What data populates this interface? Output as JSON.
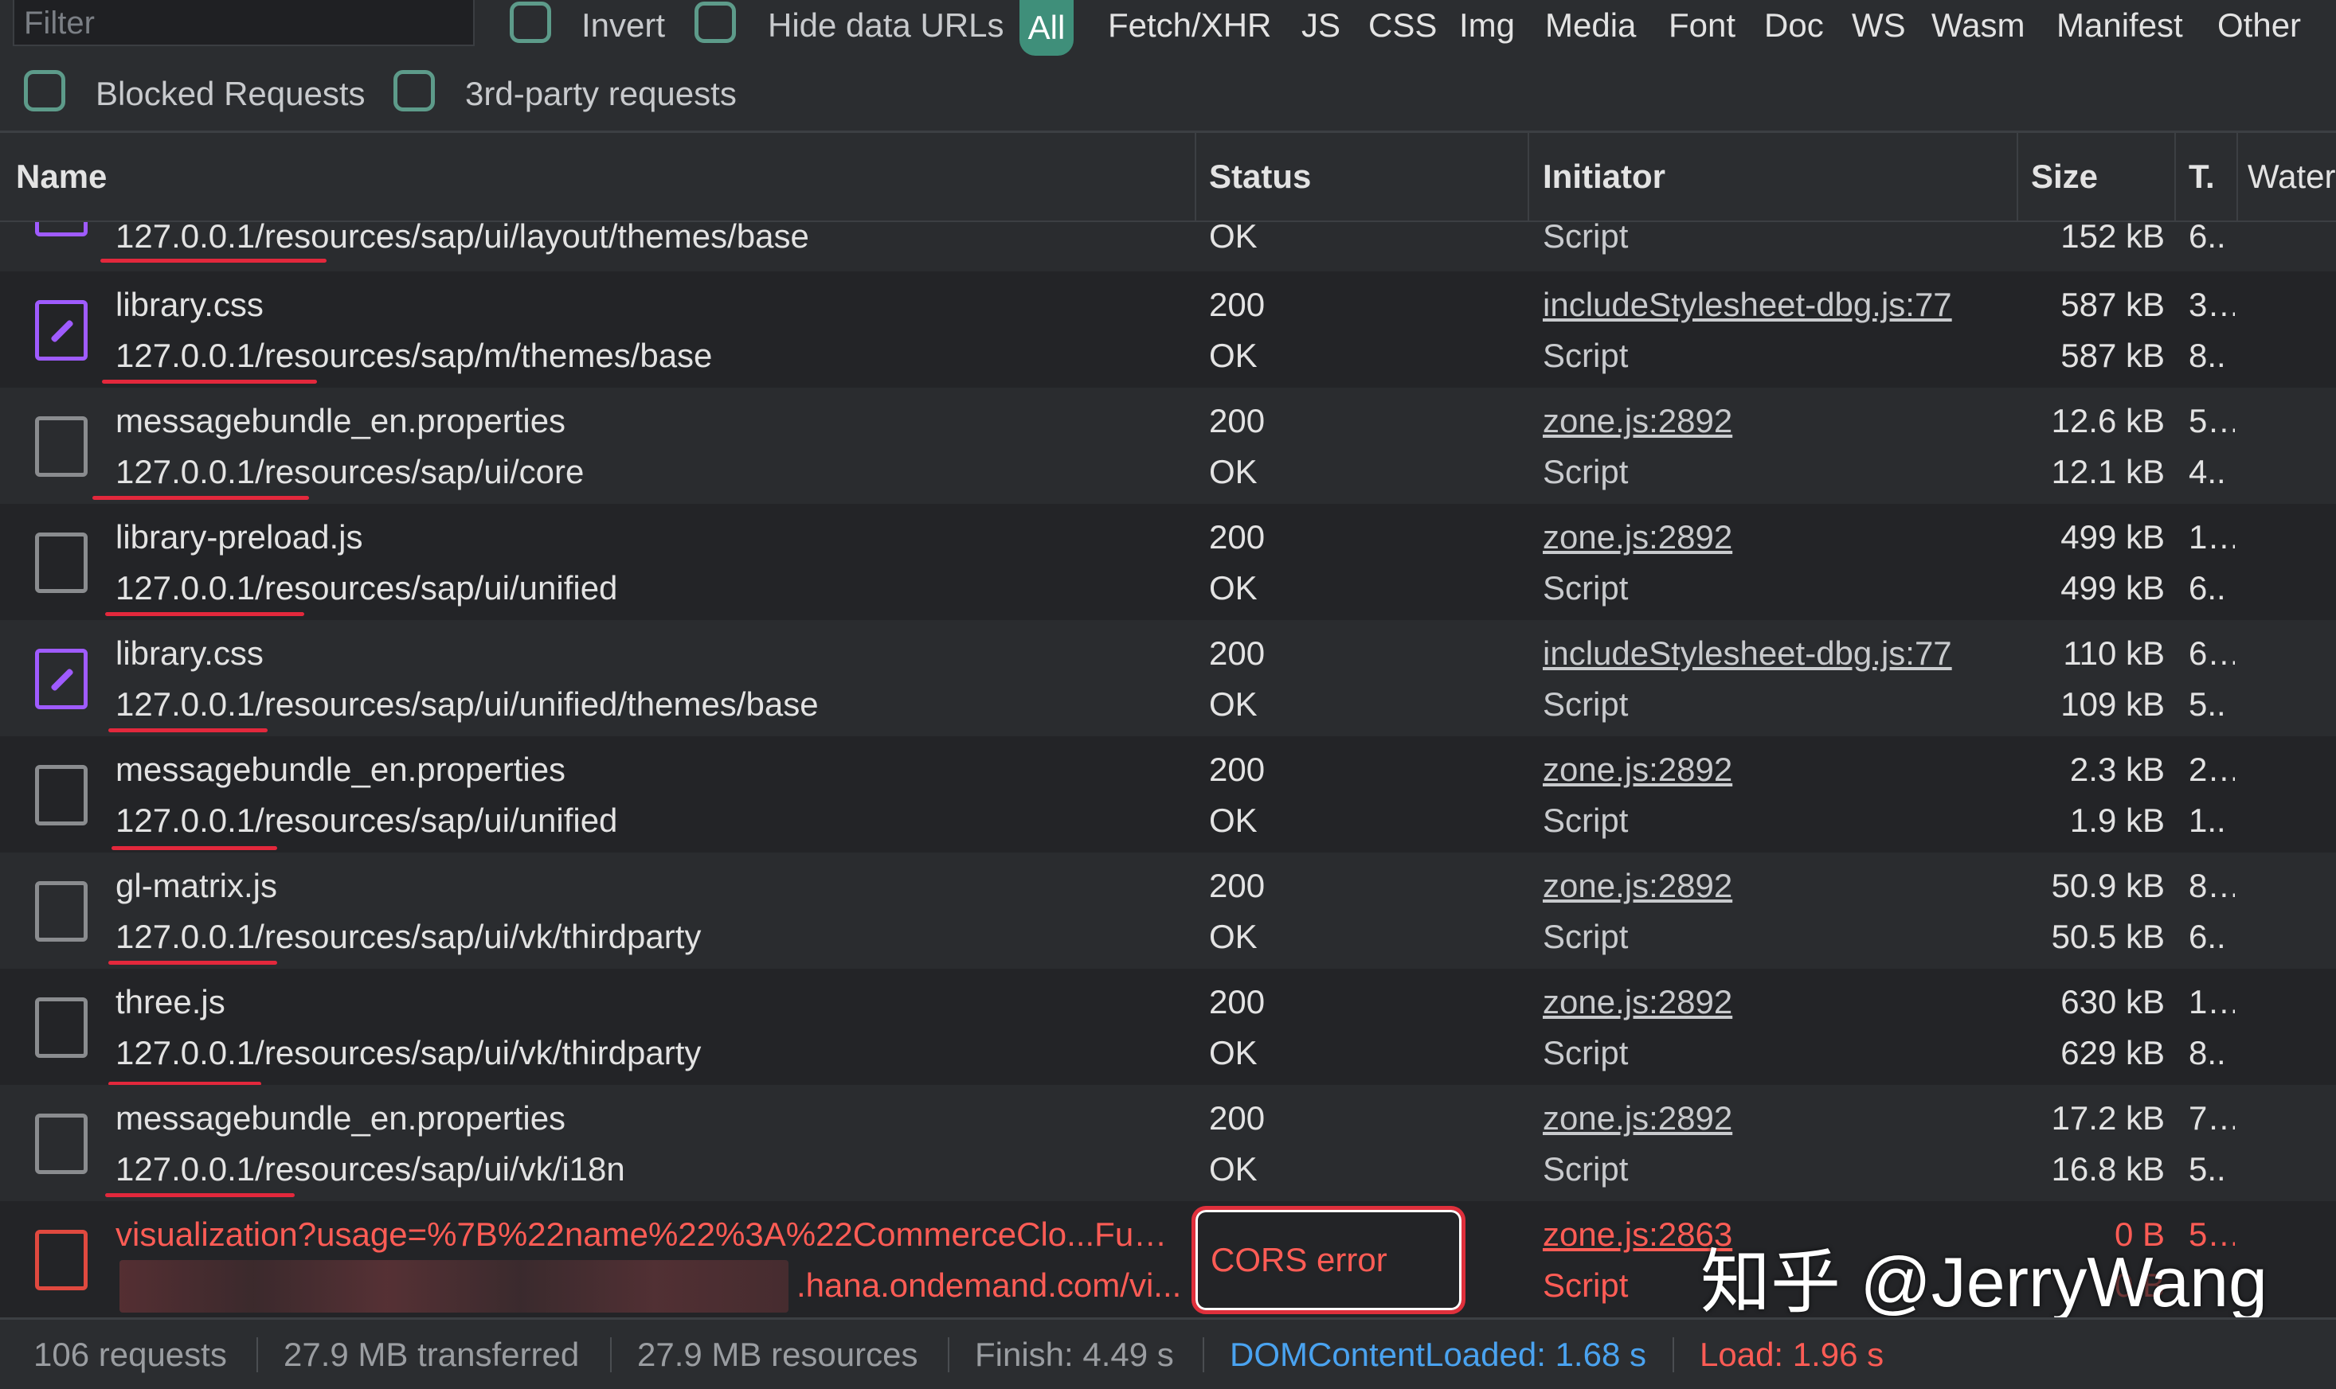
{
  "toolbar": {
    "filter_placeholder": "Filter",
    "invert_label": "Invert",
    "hide_data_urls_label": "Hide data URLs",
    "blocked_requests_label": "Blocked Requests",
    "third_party_label": "3rd-party requests",
    "types": [
      "All",
      "Fetch/XHR",
      "JS",
      "CSS",
      "Img",
      "Media",
      "Font",
      "Doc",
      "WS",
      "Wasm",
      "Manifest",
      "Other"
    ],
    "active_type": "All"
  },
  "columns": {
    "name": "Name",
    "status": "Status",
    "initiator": "Initiator",
    "size": "Size",
    "time": "T.",
    "waterfall": "Water"
  },
  "partial_row": {
    "path": "127.0.0.1/resources/sap/ui/layout/themes/base",
    "status_text": "OK",
    "initiator_type": "Script",
    "size_resource": "152 kB",
    "time2": "6.."
  },
  "rows": [
    {
      "file": "library.css",
      "path": "127.0.0.1/resources/sap/m/themes/base",
      "status": "200",
      "status_text": "OK",
      "initiator": "includeStylesheet-dbg.js:77",
      "initiator_type": "Script",
      "size_transferred": "587 kB",
      "size_resource": "587 kB",
      "time1": "3...",
      "time2": "8..",
      "icon": "css-icon"
    },
    {
      "file": "messagebundle_en.properties",
      "path": "127.0.0.1/resources/sap/ui/core",
      "status": "200",
      "status_text": "OK",
      "initiator": "zone.js:2892",
      "initiator_type": "Script",
      "size_transferred": "12.6 kB",
      "size_resource": "12.1 kB",
      "time1": "5...",
      "time2": "4..",
      "icon": "document-icon"
    },
    {
      "file": "library-preload.js",
      "path": "127.0.0.1/resources/sap/ui/unified",
      "status": "200",
      "status_text": "OK",
      "initiator": "zone.js:2892",
      "initiator_type": "Script",
      "size_transferred": "499 kB",
      "size_resource": "499 kB",
      "time1": "1...",
      "time2": "6..",
      "icon": "document-icon"
    },
    {
      "file": "library.css",
      "path": "127.0.0.1/resources/sap/ui/unified/themes/base",
      "status": "200",
      "status_text": "OK",
      "initiator": "includeStylesheet-dbg.js:77",
      "initiator_type": "Script",
      "size_transferred": "110 kB",
      "size_resource": "109 kB",
      "time1": "6...",
      "time2": "5..",
      "icon": "css-icon"
    },
    {
      "file": "messagebundle_en.properties",
      "path": "127.0.0.1/resources/sap/ui/unified",
      "status": "200",
      "status_text": "OK",
      "initiator": "zone.js:2892",
      "initiator_type": "Script",
      "size_transferred": "2.3 kB",
      "size_resource": "1.9 kB",
      "time1": "2...",
      "time2": "1..",
      "icon": "document-icon"
    },
    {
      "file": "gl-matrix.js",
      "path": "127.0.0.1/resources/sap/ui/vk/thirdparty",
      "status": "200",
      "status_text": "OK",
      "initiator": "zone.js:2892",
      "initiator_type": "Script",
      "size_transferred": "50.9 kB",
      "size_resource": "50.5 kB",
      "time1": "8...",
      "time2": "6..",
      "icon": "document-icon"
    },
    {
      "file": "three.js",
      "path": "127.0.0.1/resources/sap/ui/vk/thirdparty",
      "status": "200",
      "status_text": "OK",
      "initiator": "zone.js:2892",
      "initiator_type": "Script",
      "size_transferred": "630 kB",
      "size_resource": "629 kB",
      "time1": "1...",
      "time2": "8..",
      "icon": "document-icon"
    },
    {
      "file": "messagebundle_en.properties",
      "path": "127.0.0.1/resources/sap/ui/vk/i18n",
      "status": "200",
      "status_text": "OK",
      "initiator": "zone.js:2892",
      "initiator_type": "Script",
      "size_transferred": "17.2 kB",
      "size_resource": "16.8 kB",
      "time1": "7...",
      "time2": "5..",
      "icon": "document-icon"
    }
  ],
  "error_row": {
    "file": "visualization?usage=%7B%22name%22%3A%22CommerceClo...Funct...",
    "path": ".hana.ondemand.com/vi...",
    "status": "CORS error",
    "initiator": "zone.js:2863",
    "initiator_type": "Script",
    "size_transferred": "0 B",
    "size_resource": "0 B",
    "time1": "5...",
    "icon": "error-document-icon"
  },
  "statusbar": {
    "requests": "106 requests",
    "transferred": "27.9 MB transferred",
    "resources": "27.9 MB resources",
    "finish": "Finish: 4.49 s",
    "dom_content_loaded": "DOMContentLoaded: 1.68 s",
    "load": "Load: 1.96 s"
  },
  "watermark": "知乎 @JerryWang",
  "colors": {
    "accent": "#3f8f7a",
    "checkbox": "#5d9b8a",
    "css_icon": "#9f5bff",
    "error": "#ff5c55",
    "dom_content_loaded": "#4aa3f0",
    "load": "#ff5c55",
    "annotation": "#e3283c"
  }
}
